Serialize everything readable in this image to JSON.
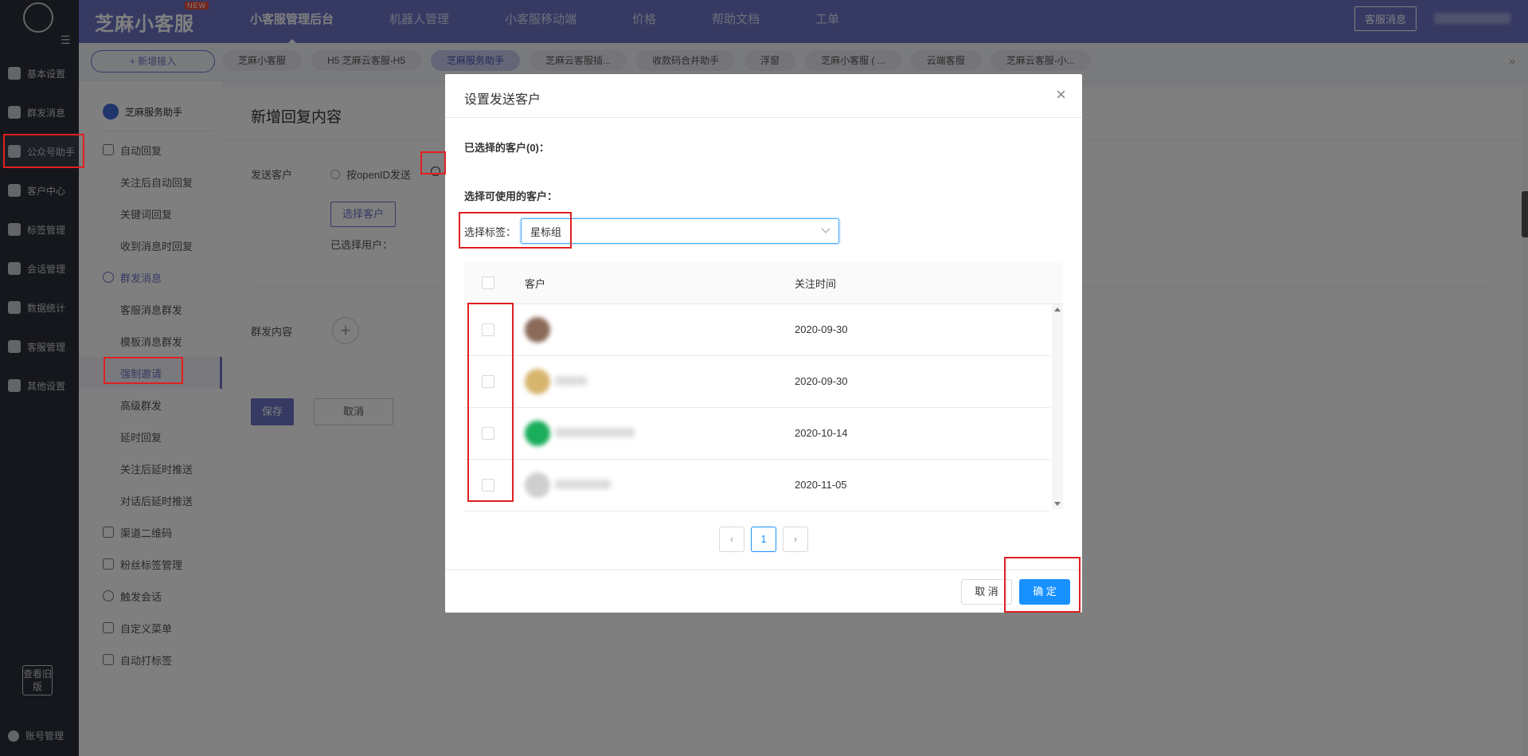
{
  "rail": {
    "items": [
      {
        "label": "基本设置"
      },
      {
        "label": "群发消息"
      },
      {
        "label": "公众号助手"
      },
      {
        "label": "客户中心"
      },
      {
        "label": "标签管理"
      },
      {
        "label": "会话管理"
      },
      {
        "label": "数据统计"
      },
      {
        "label": "客服管理"
      },
      {
        "label": "其他设置"
      }
    ],
    "old_version": "查看旧版",
    "account": "账号管理"
  },
  "topbar": {
    "brand": "芝麻小客服",
    "badge": "NEW",
    "nav": [
      "小客服管理后台",
      "机器人管理",
      "小客服移动端",
      "价格",
      "帮助文档",
      "工单"
    ],
    "right_button": "客服消息"
  },
  "tabstrip": {
    "new_button": "+ 新增接入",
    "tabs": [
      "芝麻小客服",
      "H5 芝麻云客服-H5",
      "芝麻服务助手",
      "芝麻云客服插...",
      "收款码合并助手",
      "浮窗",
      "芝麻小客服 ( ...",
      "云端客服",
      "芝麻云客服-小..."
    ]
  },
  "subside": {
    "head": "芝麻服务助手",
    "items": [
      {
        "label": "自动回复",
        "kind": "group"
      },
      {
        "label": "关注后自动回复",
        "kind": "child"
      },
      {
        "label": "关键词回复",
        "kind": "child"
      },
      {
        "label": "收到消息时回复",
        "kind": "child"
      },
      {
        "label": "群发消息",
        "kind": "group"
      },
      {
        "label": "客服消息群发",
        "kind": "child"
      },
      {
        "label": "模板消息群发",
        "kind": "child"
      },
      {
        "label": "强制邀请",
        "kind": "child"
      },
      {
        "label": "高级群发",
        "kind": "child"
      },
      {
        "label": "延时回复",
        "kind": "child"
      },
      {
        "label": "关注后延时推送",
        "kind": "child"
      },
      {
        "label": "对话后延时推送",
        "kind": "child"
      },
      {
        "label": "渠道二维码",
        "kind": "group"
      },
      {
        "label": "粉丝标签管理",
        "kind": "group"
      },
      {
        "label": "触发会话",
        "kind": "group"
      },
      {
        "label": "自定义菜单",
        "kind": "group"
      },
      {
        "label": "自动打标签",
        "kind": "group"
      }
    ]
  },
  "content": {
    "title": "新增回复内容",
    "send_to_label": "发送客户",
    "radio_openid": "按openID发送",
    "pick_button": "选择客户",
    "selected_users": "已选择用户：",
    "content_label": "群发内容",
    "save": "保存",
    "cancel": "取消"
  },
  "modal": {
    "title": "设置发送客户",
    "selected_label": "已选择的客户(0)：",
    "available_label": "选择可使用的客户：",
    "tag_label": "选择标签：",
    "tag_value": "星标组",
    "columns": [
      "客户",
      "关注时间"
    ],
    "rows": [
      {
        "date": "2020-09-30"
      },
      {
        "date": "2020-09-30"
      },
      {
        "date": "2020-10-14"
      },
      {
        "date": "2020-11-05"
      }
    ],
    "page": "1",
    "cancel": "取 消",
    "ok": "确 定"
  }
}
